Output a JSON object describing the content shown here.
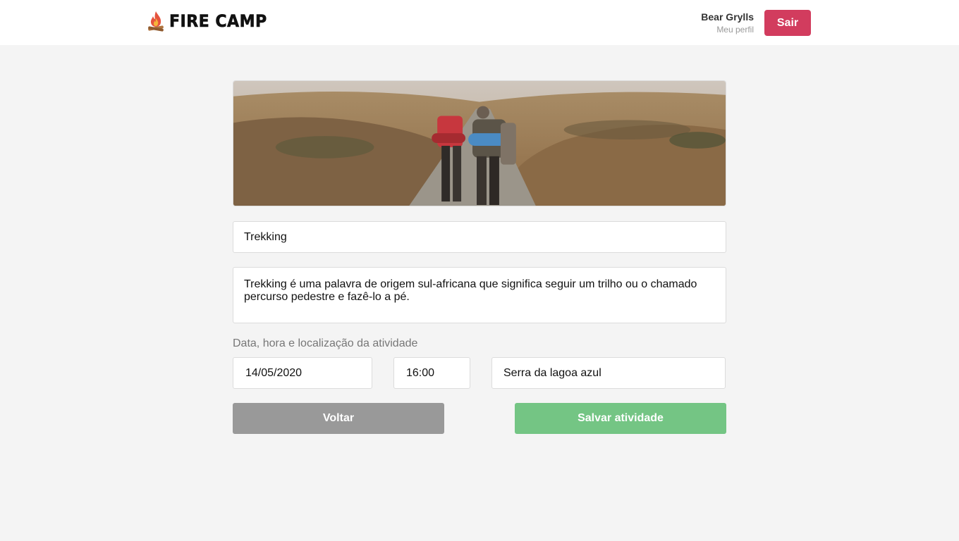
{
  "header": {
    "brand": "FIRE CAMP",
    "user_name": "Bear Grylls",
    "profile_link": "Meu perfil",
    "logout_label": "Sair"
  },
  "activity": {
    "title": "Trekking",
    "description": "Trekking é uma palavra de origem sul-africana que significa seguir um trilho ou o chamado percurso pedestre e fazê-lo a pé.",
    "schedule_label": "Data, hora e localização da atividade",
    "date": "14/05/2020",
    "time": "16:00",
    "location": "Serra da lagoa azul"
  },
  "actions": {
    "back_label": "Voltar",
    "save_label": "Salvar atividade"
  },
  "colors": {
    "accent_logout": "#d23c5e",
    "save_button": "#74c584",
    "back_button": "#999999",
    "background": "#f4f4f4"
  },
  "icons": {
    "logo": "campfire-icon"
  }
}
